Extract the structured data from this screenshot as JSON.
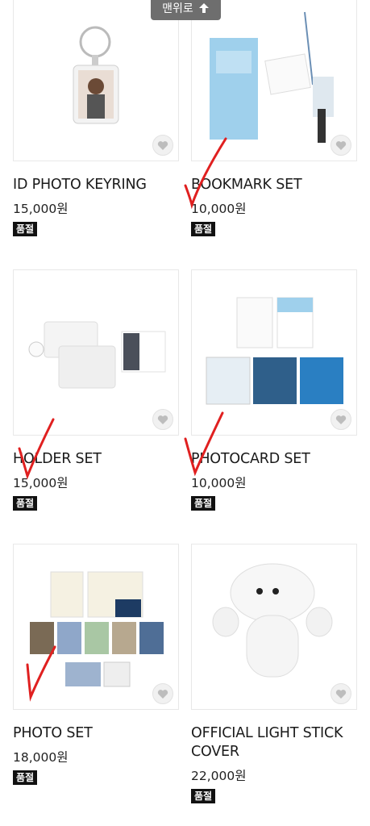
{
  "scroll_top": {
    "label": "맨위로",
    "icon": "arrow-up-icon"
  },
  "products": [
    {
      "name": "ID PHOTO KEYRING",
      "price": "15,000원",
      "badge": "품절"
    },
    {
      "name": "BOOKMARK SET",
      "price": "10,000원",
      "badge": "품절"
    },
    {
      "name": "HOLDER SET",
      "price": "15,000원",
      "badge": "품절"
    },
    {
      "name": "PHOTOCARD SET",
      "price": "10,000원",
      "badge": "품절"
    },
    {
      "name": "PHOTO SET",
      "price": "18,000원",
      "badge": "품절"
    },
    {
      "name": "OFFICIAL LIGHT STICK COVER",
      "price": "22,000원",
      "badge": "품절"
    }
  ],
  "colors": {
    "badge_bg": "#111111",
    "check_mark": "#e02020",
    "bookmark_blue": "#9fd0ec"
  }
}
